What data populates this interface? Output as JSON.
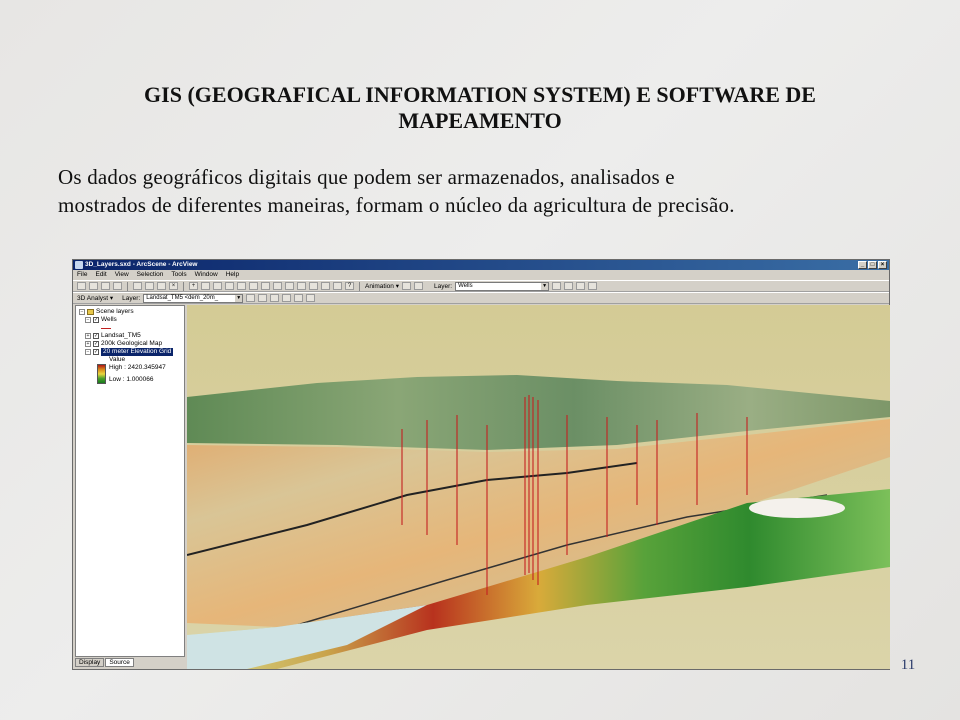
{
  "slide": {
    "title_line1": "GIS (GEOGRAFICAL INFORMATION SYSTEM) E SOFTWARE DE",
    "title_line2": "MAPEAMENTO",
    "body_line1": "Os dados geográficos digitais que podem ser armazenados, analisados e",
    "body_line2": "mostrados de diferentes maneiras, formam o núcleo da agricultura de precisão.",
    "page_number": "11"
  },
  "window": {
    "title": "3D_Layers.sxd - ArcScene - ArcView",
    "menu": [
      "File",
      "Edit",
      "View",
      "Selection",
      "Tools",
      "Window",
      "Help"
    ],
    "toolbar": {
      "animation_label": "Animation ▾",
      "layer_label": "Layer:",
      "layer_value": "Wells",
      "analyst_label": "3D Analyst ▾",
      "analyst_layer_label": "Layer:",
      "analyst_layer_value": "Landsat_TM5 <dem_20m_"
    },
    "toc": {
      "root": "Scene layers",
      "layers": [
        {
          "name": "Wells",
          "checked": true
        },
        {
          "name": "Landsat_TM5",
          "checked": true
        },
        {
          "name": "200k Geological Map",
          "checked": true
        },
        {
          "name": "20 meter Elevation Grid",
          "checked": true,
          "selected": true
        }
      ],
      "legend_title": "Value",
      "legend_high": "High : 2420.345947",
      "legend_low": "Low : 1.000066"
    },
    "tabs": [
      "Display",
      "Source"
    ],
    "active_tab": "Source"
  },
  "colors": {
    "sky": "#d6ce9e",
    "title_bar": "#0a246a",
    "page_number": "#2a3a6a"
  }
}
